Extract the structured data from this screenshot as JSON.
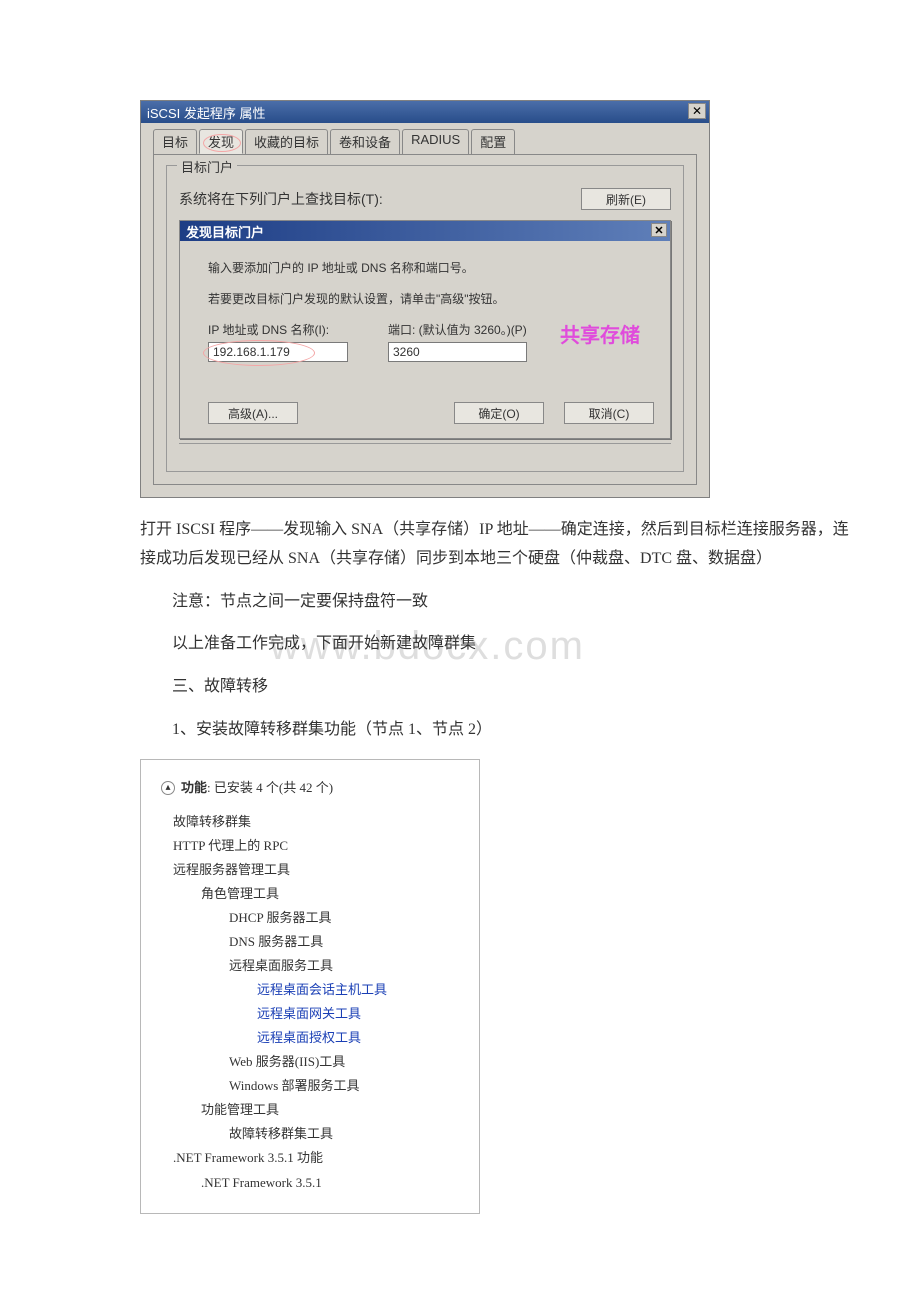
{
  "dlg": {
    "title": "iSCSI 发起程序 属性",
    "close": "✕",
    "tabs": [
      "目标",
      "发现",
      "收藏的目标",
      "卷和设备",
      "RADIUS",
      "配置"
    ],
    "group_label": "目标门户",
    "group_text": "系统将在下列门户上查找目标(T):",
    "refresh_btn": "刷新(E)"
  },
  "inner": {
    "title": "发现目标门户",
    "close": "✕",
    "line1": "输入要添加门户的 IP 地址或 DNS 名称和端口号。",
    "line2": "若要更改目标门户发现的默认设置，请单击\"高级\"按钮。",
    "ip_label": "IP 地址或 DNS 名称(I):",
    "ip_value": "192.168.1.179",
    "port_label": "端口: (默认值为 3260。)(P)",
    "port_value": "3260",
    "overlay": "共享存储",
    "adv_btn": "高级(A)...",
    "ok_btn": "确定(O)",
    "cancel_btn": "取消(C)"
  },
  "body": {
    "p1": "打开 ISCSI 程序——发现输入 SNA（共享存储）IP 地址——确定连接，然后到目标栏连接服务器，连接成功后发现已经从 SNA（共享存储）同步到本地三个硬盘（仲裁盘、DTC 盘、数据盘）",
    "p2": "注意：节点之间一定要保持盘符一致",
    "p3": "以上准备工作完成，下面开始新建故障群集",
    "wm": "www.bdocx.com",
    "h3": "三、故障转移",
    "p4": "1、安装故障转移群集功能（节点 1、节点 2）"
  },
  "features": {
    "header_bold": "功能",
    "header_rest": ": 已安装 4 个(共 42 个)",
    "collapse": "▴",
    "items": {
      "a": "故障转移群集",
      "b": "HTTP 代理上的 RPC",
      "c": "远程服务器管理工具",
      "c1": "角色管理工具",
      "c1a": "DHCP 服务器工具",
      "c1b": "DNS 服务器工具",
      "c1c": "远程桌面服务工具",
      "c1c1": "远程桌面会话主机工具",
      "c1c2": "远程桌面网关工具",
      "c1c3": "远程桌面授权工具",
      "c1d": "Web 服务器(IIS)工具",
      "c1e": "Windows 部署服务工具",
      "c2": "功能管理工具",
      "c2a": "故障转移群集工具",
      "d": ".NET Framework 3.5.1 功能",
      "d1": ".NET Framework 3.5.1"
    }
  }
}
